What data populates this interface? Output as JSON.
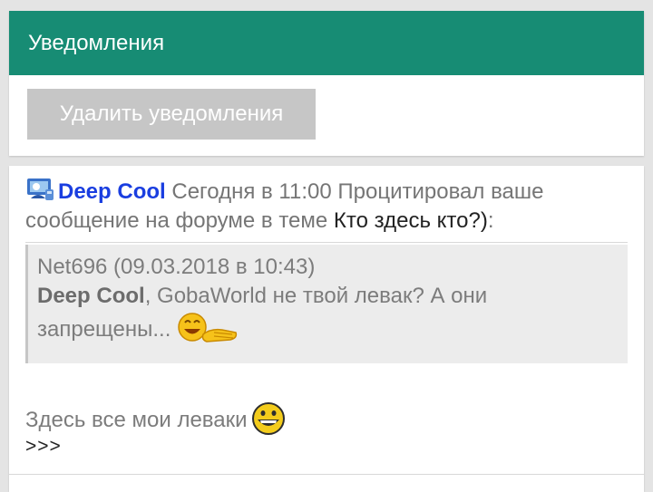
{
  "header": {
    "title": "Уведомления"
  },
  "actions": {
    "delete_label": "Удалить уведомления"
  },
  "notification": {
    "user": "Deep Cool",
    "time": "Сегодня в 11:00",
    "message": "Процитировал ваше сообщение на форуме в теме",
    "topic": "Кто здесь кто?)",
    "suffix": ":",
    "quote": {
      "meta": "Net696 (09.03.2018 в 10:43)",
      "addressee": "Deep Cool",
      "text_line1": ", GobaWorld не твой левак? А они",
      "text_line2": "запрещены..."
    },
    "reply": "Здесь все мои леваки",
    "more_link": ">>>"
  },
  "colors": {
    "header_bg": "#178c74",
    "button_bg": "#c6c6c6",
    "user_link": "#1a3ee0"
  },
  "icons": [
    "user-avatar-icon",
    "smile-wave-emoji-icon",
    "grin-emoji-icon"
  ]
}
